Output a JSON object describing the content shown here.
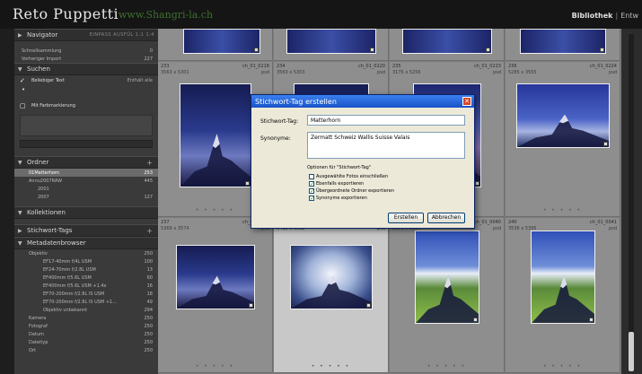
{
  "app": {
    "brand_name": "Reto Puppetti",
    "brand_url": "www.Shangri-la.ch",
    "module_active": "Bibliothek",
    "module_next": "Entw"
  },
  "left_panel": {
    "navigator_label": "Navigator",
    "navigator_options": "EINPASS  AUSFÜL  1:1  1:4",
    "catalog_rows": [
      {
        "label": "Schnellsammlung",
        "count": "0"
      },
      {
        "label": "Vorheriger Import",
        "count": "227"
      }
    ],
    "search_label": "Suchen",
    "search_filter": "Beliebiger Text",
    "search_filter_right": "Enthält alle",
    "keyword_toggle": "Mit Farbmarkierung",
    "folders_label": "Ordner",
    "folder_rows": [
      {
        "label": "01Matterhorn",
        "count": "253",
        "selected": true
      },
      {
        "label": "Annu2007RAW",
        "count": "445",
        "selected": false
      },
      {
        "label": "2001",
        "count": "",
        "selected": false
      },
      {
        "label": "2007",
        "count": "127",
        "selected": false
      }
    ],
    "collections_label": "Kollektionen",
    "keyword_tags_label": "Stichwort-Tags",
    "metadata_label": "Metadatenbrowser",
    "metadata_rows": [
      {
        "label": "Objektiv",
        "count": "250",
        "level": 1
      },
      {
        "label": "EF17-40mm f/4L USM",
        "count": "100",
        "level": 2
      },
      {
        "label": "EF24-70mm f/2.8L USM",
        "count": "13",
        "level": 2
      },
      {
        "label": "EF400mm f/5.6L USM",
        "count": "60",
        "level": 2
      },
      {
        "label": "EF400mm f/5.6L USM +1.4x",
        "count": "16",
        "level": 2
      },
      {
        "label": "EF70-200mm f/2.8L IS USM",
        "count": "18",
        "level": 2
      },
      {
        "label": "EF70-200mm f/2.8L IS USM +1...",
        "count": "49",
        "level": 2
      },
      {
        "label": "Objektiv unbekannt",
        "count": "294",
        "level": 2
      },
      {
        "label": "Kamera",
        "count": "250",
        "level": 1
      },
      {
        "label": "Fotograf",
        "count": "250",
        "level": 1
      },
      {
        "label": "Datum",
        "count": "250",
        "level": 1
      },
      {
        "label": "Dateityp",
        "count": "250",
        "level": 1
      },
      {
        "label": "Ort",
        "count": "250",
        "level": 1
      }
    ]
  },
  "grid": {
    "cells": [
      {
        "num": "233",
        "file": "ch_01_0218",
        "dims": "3563 x 5301",
        "ext": "psd",
        "img": "img-night"
      },
      {
        "num": "234",
        "file": "ch_01_0220",
        "dims": "3563 x 5303",
        "ext": "psd",
        "img": "img-night"
      },
      {
        "num": "235",
        "file": "ch_01_0223",
        "dims": "3175 x 5256",
        "ext": "psd",
        "img": "img-dusk"
      },
      {
        "num": "236",
        "file": "ch_01_0224",
        "dims": "5285 x 3555",
        "ext": "psd",
        "img": "img-blue"
      },
      {
        "num": "237",
        "file": "ch_01_0040",
        "dims": "5369 x 3574",
        "ext": "psd",
        "img": "img-night"
      },
      {
        "num": "238",
        "file": "ch_01_0039",
        "dims": "5432 x 3532",
        "ext": "psd",
        "img": "img-cloud"
      },
      {
        "num": "239",
        "file": "ch_01_0040",
        "dims": "3576 x 5324",
        "ext": "psd",
        "img": "img-green"
      },
      {
        "num": "240",
        "file": "ch_01_0041",
        "dims": "3536 x 5395",
        "ext": "psd",
        "img": "img-green"
      }
    ]
  },
  "dialog": {
    "title": "Stichwort-Tag erstellen",
    "tag_label": "Stichwort-Tag:",
    "tag_value": "Matterhorn",
    "synonyms_label": "Synonyme:",
    "synonyms_value": "Zermatt Schweiz Wallis Suisse Valais",
    "options_title": "Optionen für \"Stichwort-Tag\"",
    "options": [
      {
        "label": "Ausgewählte Fotos einschließen",
        "checked": false
      },
      {
        "label": "Ebenfalls exportieren",
        "checked": true
      },
      {
        "label": "Übergeordnete Ordner exportieren",
        "checked": true
      },
      {
        "label": "Synonyme exportieren",
        "checked": true
      }
    ],
    "create_button": "Erstellen",
    "cancel_button": "Abbrechen"
  }
}
